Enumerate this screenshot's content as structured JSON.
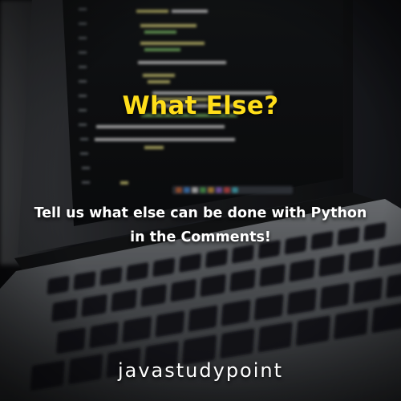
{
  "headline": "What Else?",
  "subtitle": {
    "line1": "Tell us what else can be done with Python",
    "line2": "in the Comments!"
  },
  "brand": "javastudypoint",
  "colors": {
    "headline": "#ffde1a",
    "text": "#ffffff",
    "code_yellow": "#d8d27a",
    "code_green": "#7fbf6a",
    "code_white": "#dcdcdc"
  },
  "background_photo": {
    "subject": "laptop-with-code-on-screen",
    "icon": "laptop-icon"
  }
}
